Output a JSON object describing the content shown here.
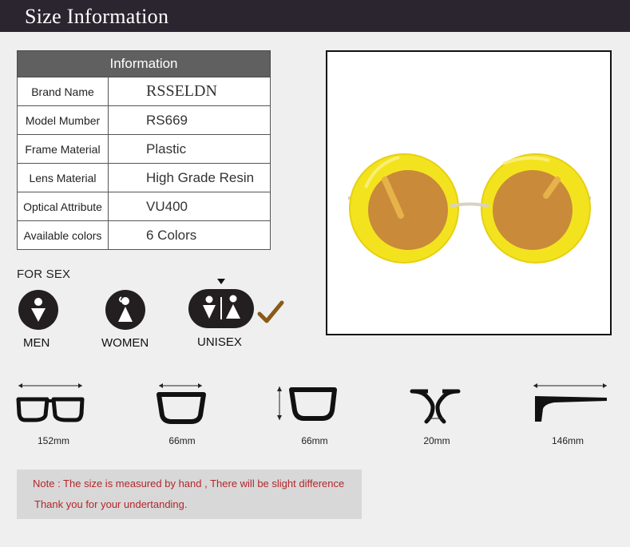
{
  "header": {
    "title": "Size Information"
  },
  "info_table": {
    "title": "Information",
    "rows": [
      {
        "label": "Brand Name",
        "value": "RSSELDN"
      },
      {
        "label": "Model Mumber",
        "value": "RS669"
      },
      {
        "label": "Frame Material",
        "value": "Plastic"
      },
      {
        "label": "Lens Material",
        "value": "High Grade Resin"
      },
      {
        "label": "Optical Attribute",
        "value": "VU400"
      },
      {
        "label": "Available colors",
        "value": "6 Colors"
      }
    ]
  },
  "product_image": {
    "frame_color": "#f3e31f",
    "lens_color": "#c98a3a",
    "temple_color": "#e7b24a",
    "metal_color": "#d9d2c0"
  },
  "sex": {
    "title": "FOR SEX",
    "options": [
      {
        "label": "MEN",
        "icon": "male-icon"
      },
      {
        "label": "WOMEN",
        "icon": "female-icon"
      },
      {
        "label": "UNISEX",
        "icon": "unisex-icon",
        "selected": true
      }
    ],
    "check_color": "#8a5a17"
  },
  "dimensions": [
    {
      "label": "152mm",
      "icon": "frame-width-icon"
    },
    {
      "label": "66mm",
      "icon": "lens-width-icon"
    },
    {
      "label": "66mm",
      "icon": "lens-height-icon"
    },
    {
      "label": "20mm",
      "icon": "bridge-width-icon"
    },
    {
      "label": "146mm",
      "icon": "temple-length-icon"
    }
  ],
  "note": {
    "line1": "Note : The size is measured by hand , There will be slight difference",
    "line2": "Thank you for your undertanding."
  }
}
